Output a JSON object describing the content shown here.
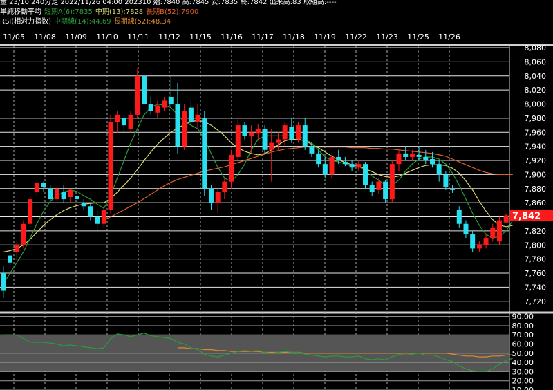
{
  "header": {
    "line1": "金 23/10 240分足 2022/11/26 04:00 202310 始:7840 高:7845 安:7835 終:7842 出来高:83 取組高:----",
    "line2_title": "単純移動平均",
    "line2_short": "短期A(6):7835",
    "line2_mid": "中期(13):7828",
    "line2_long": "長期B(52):7900",
    "line3_title": "RSI(相対力指数)",
    "line3_mid": "中期線(14):44.69",
    "line3_long": "長期線(52):48.34"
  },
  "colors": {
    "up": "#ff1a1a",
    "down": "#29e0f0",
    "ma_short": "#2a9d3a",
    "ma_mid": "#d8d870",
    "ma_long": "#e0602a",
    "rsi_mid": "#2a9d3a",
    "rsi_long": "#e08a2a",
    "price_tag": "#ff1a1a"
  },
  "current_price_label": "7,842",
  "chart_data": [
    {
      "type": "candlestick",
      "x_dates": [
        "11/05",
        "11/08",
        "11/09",
        "11/10",
        "11/11",
        "11/12",
        "11/15",
        "11/16",
        "11/17",
        "11/18",
        "11/19",
        "11/22",
        "11/23",
        "11/25",
        "11/26"
      ],
      "y_ticks": [
        "8,080",
        "8,060",
        "8,040",
        "8,020",
        "8,000",
        "7,980",
        "7,960",
        "7,940",
        "7,920",
        "7,900",
        "7,880",
        "7,860",
        "7,840",
        "7,820",
        "7,800",
        "7,780",
        "7,760",
        "7,740",
        "7,720"
      ],
      "ylim": [
        7710,
        8082
      ],
      "grid": true,
      "candles": [
        [
          7760,
          7770,
          7725,
          7735
        ],
        [
          7785,
          7800,
          7770,
          7775
        ],
        [
          7790,
          7805,
          7780,
          7800
        ],
        [
          7800,
          7835,
          7795,
          7830
        ],
        [
          7830,
          7870,
          7825,
          7865
        ],
        [
          7875,
          7890,
          7870,
          7888
        ],
        [
          7888,
          7890,
          7875,
          7882
        ],
        [
          7880,
          7885,
          7860,
          7865
        ],
        [
          7865,
          7882,
          7860,
          7880
        ],
        [
          7875,
          7885,
          7860,
          7865
        ],
        [
          7868,
          7880,
          7860,
          7878
        ],
        [
          7870,
          7882,
          7860,
          7865
        ],
        [
          7860,
          7865,
          7850,
          7855
        ],
        [
          7855,
          7860,
          7835,
          7840
        ],
        [
          7840,
          7850,
          7820,
          7830
        ],
        [
          7830,
          7855,
          7825,
          7850
        ],
        [
          7850,
          7985,
          7845,
          7975
        ],
        [
          7975,
          7990,
          7960,
          7985
        ],
        [
          7980,
          7985,
          7960,
          7970
        ],
        [
          7965,
          7990,
          7958,
          7985
        ],
        [
          7985,
          8050,
          7980,
          8040
        ],
        [
          8040,
          8045,
          7990,
          8000
        ],
        [
          8000,
          8010,
          7985,
          7990
        ],
        [
          7988,
          8005,
          7980,
          7998
        ],
        [
          7995,
          8010,
          7990,
          8005
        ],
        [
          8010,
          8040,
          7995,
          8000
        ],
        [
          8000,
          8030,
          7930,
          7940
        ],
        [
          7940,
          8000,
          7935,
          7990
        ],
        [
          7995,
          8005,
          7970,
          7975
        ],
        [
          7975,
          8000,
          7965,
          7985
        ],
        [
          7980,
          7990,
          7870,
          7880
        ],
        [
          7880,
          7885,
          7850,
          7860
        ],
        [
          7860,
          7880,
          7845,
          7875
        ],
        [
          7875,
          7895,
          7865,
          7890
        ],
        [
          7890,
          7935,
          7880,
          7928
        ],
        [
          7925,
          7980,
          7918,
          7970
        ],
        [
          7970,
          7975,
          7950,
          7955
        ],
        [
          7955,
          7970,
          7930,
          7960
        ],
        [
          7958,
          7972,
          7948,
          7965
        ],
        [
          7965,
          7970,
          7930,
          7935
        ],
        [
          7935,
          7965,
          7890,
          7945
        ],
        [
          7945,
          7960,
          7935,
          7950
        ],
        [
          7950,
          7975,
          7940,
          7970
        ],
        [
          7968,
          7980,
          7945,
          7950
        ],
        [
          7950,
          7975,
          7945,
          7970
        ],
        [
          7970,
          7980,
          7935,
          7940
        ],
        [
          7940,
          7945,
          7925,
          7930
        ],
        [
          7930,
          7935,
          7910,
          7915
        ],
        [
          7915,
          7925,
          7895,
          7900
        ],
        [
          7900,
          7928,
          7895,
          7925
        ],
        [
          7925,
          7935,
          7915,
          7920
        ],
        [
          7918,
          7925,
          7912,
          7915
        ],
        [
          7915,
          7920,
          7905,
          7910
        ],
        [
          7910,
          7920,
          7905,
          7915
        ],
        [
          7915,
          7918,
          7880,
          7885
        ],
        [
          7885,
          7890,
          7870,
          7875
        ],
        [
          7878,
          7895,
          7872,
          7890
        ],
        [
          7890,
          7892,
          7860,
          7865
        ],
        [
          7865,
          7920,
          7860,
          7915
        ],
        [
          7915,
          7935,
          7905,
          7930
        ],
        [
          7930,
          7940,
          7920,
          7925
        ],
        [
          7925,
          7935,
          7920,
          7930
        ],
        [
          7928,
          7940,
          7920,
          7925
        ],
        [
          7925,
          7935,
          7915,
          7920
        ],
        [
          7922,
          7932,
          7910,
          7915
        ],
        [
          7915,
          7920,
          7890,
          7900
        ],
        [
          7900,
          7905,
          7878,
          7882
        ],
        [
          7880,
          7885,
          7874,
          7878
        ],
        [
          7850,
          7855,
          7825,
          7830
        ],
        [
          7830,
          7835,
          7810,
          7815
        ],
        [
          7815,
          7820,
          7790,
          7795
        ],
        [
          7795,
          7805,
          7790,
          7800
        ],
        [
          7800,
          7815,
          7795,
          7810
        ],
        [
          7810,
          7830,
          7805,
          7825
        ],
        [
          7805,
          7840,
          7800,
          7835
        ],
        [
          7832,
          7845,
          7835,
          7842
        ]
      ],
      "ma_short": [
        7745,
        7760,
        7775,
        7790,
        7810,
        7830,
        7848,
        7862,
        7870,
        7875,
        7878,
        7876,
        7870,
        7865,
        7858,
        7852,
        7870,
        7895,
        7920,
        7945,
        7965,
        7985,
        7995,
        8000,
        7998,
        7995,
        7985,
        7975,
        7970,
        7965,
        7950,
        7930,
        7910,
        7895,
        7890,
        7900,
        7915,
        7935,
        7950,
        7955,
        7955,
        7955,
        7955,
        7955,
        7955,
        7950,
        7945,
        7935,
        7925,
        7920,
        7918,
        7915,
        7912,
        7912,
        7905,
        7898,
        7892,
        7885,
        7885,
        7892,
        7905,
        7915,
        7922,
        7925,
        7925,
        7922,
        7915,
        7902,
        7885,
        7865,
        7845,
        7828,
        7815,
        7810,
        7812,
        7820,
        7835
      ],
      "ma_mid": [
        7790,
        7792,
        7795,
        7800,
        7808,
        7818,
        7828,
        7836,
        7843,
        7849,
        7853,
        7856,
        7858,
        7859,
        7860,
        7860,
        7866,
        7875,
        7885,
        7895,
        7907,
        7920,
        7932,
        7943,
        7952,
        7960,
        7966,
        7971,
        7975,
        7977,
        7975,
        7970,
        7963,
        7955,
        7945,
        7938,
        7933,
        7930,
        7928,
        7930,
        7935,
        7942,
        7948,
        7950,
        7950,
        7948,
        7943,
        7938,
        7932,
        7926,
        7921,
        7917,
        7914,
        7912,
        7908,
        7904,
        7900,
        7897,
        7896,
        7898,
        7902,
        7906,
        7910,
        7913,
        7914,
        7914,
        7913,
        7909,
        7902,
        7891,
        7878,
        7862,
        7848,
        7836,
        7828,
        7826,
        7828
      ],
      "ma_long": [
        null,
        null,
        null,
        null,
        null,
        null,
        null,
        null,
        null,
        null,
        null,
        null,
        null,
        null,
        null,
        7835,
        7840,
        7845,
        7850,
        7855,
        7860,
        7866,
        7872,
        7878,
        7884,
        7889,
        7893,
        7896,
        7899,
        7902,
        7905,
        7907,
        7909,
        7911,
        7914,
        7917,
        7920,
        7923,
        7926,
        7929,
        7932,
        7934,
        7936,
        7937,
        7938,
        7939,
        7939,
        7939,
        7939,
        7939,
        7939,
        7939,
        7938,
        7938,
        7938,
        7937,
        7937,
        7936,
        7936,
        7935,
        7934,
        7933,
        7932,
        7931,
        7930,
        7928,
        7926,
        7922,
        7918,
        7914,
        7910,
        7906,
        7903,
        7901,
        7900,
        7900,
        7900
      ]
    },
    {
      "type": "line",
      "title": "RSI",
      "y_ticks": [
        "90.00",
        "80.00",
        "70.00",
        "60.00",
        "50.00",
        "40.00",
        "30.00",
        "20.00",
        "10.00"
      ],
      "ylim": [
        10,
        92
      ],
      "series": [
        {
          "values": [
            70,
            70,
            70,
            66,
            62,
            62,
            62,
            61,
            60,
            58,
            59,
            58,
            57,
            56,
            55,
            56,
            66,
            71,
            70,
            68,
            70,
            72,
            69,
            68,
            67,
            66,
            62,
            60,
            56,
            54,
            49,
            47,
            46,
            48,
            50,
            52,
            53,
            52,
            53,
            51,
            50,
            51,
            52,
            51,
            51,
            49,
            48,
            47,
            46,
            47,
            47,
            46,
            46,
            47,
            44,
            43,
            44,
            43,
            46,
            49,
            48,
            49,
            50,
            48,
            48,
            46,
            43,
            41,
            36,
            33,
            31,
            30,
            30,
            33,
            38,
            42,
            44.69
          ]
        },
        {
          "values": [
            null,
            null,
            null,
            null,
            null,
            null,
            null,
            null,
            null,
            null,
            null,
            null,
            null,
            null,
            null,
            null,
            null,
            null,
            null,
            null,
            null,
            null,
            null,
            null,
            null,
            null,
            56,
            56,
            55,
            55,
            54,
            54,
            53,
            53,
            52,
            52,
            52,
            52,
            52,
            51,
            51,
            51,
            51,
            51,
            51,
            50,
            50,
            50,
            50,
            50,
            50,
            50,
            50,
            50,
            50,
            50,
            50,
            50,
            50,
            50,
            50,
            50,
            50,
            50,
            50,
            50,
            50,
            49,
            48,
            47,
            47,
            46,
            46,
            47,
            47,
            48,
            48.34
          ]
        }
      ]
    }
  ]
}
